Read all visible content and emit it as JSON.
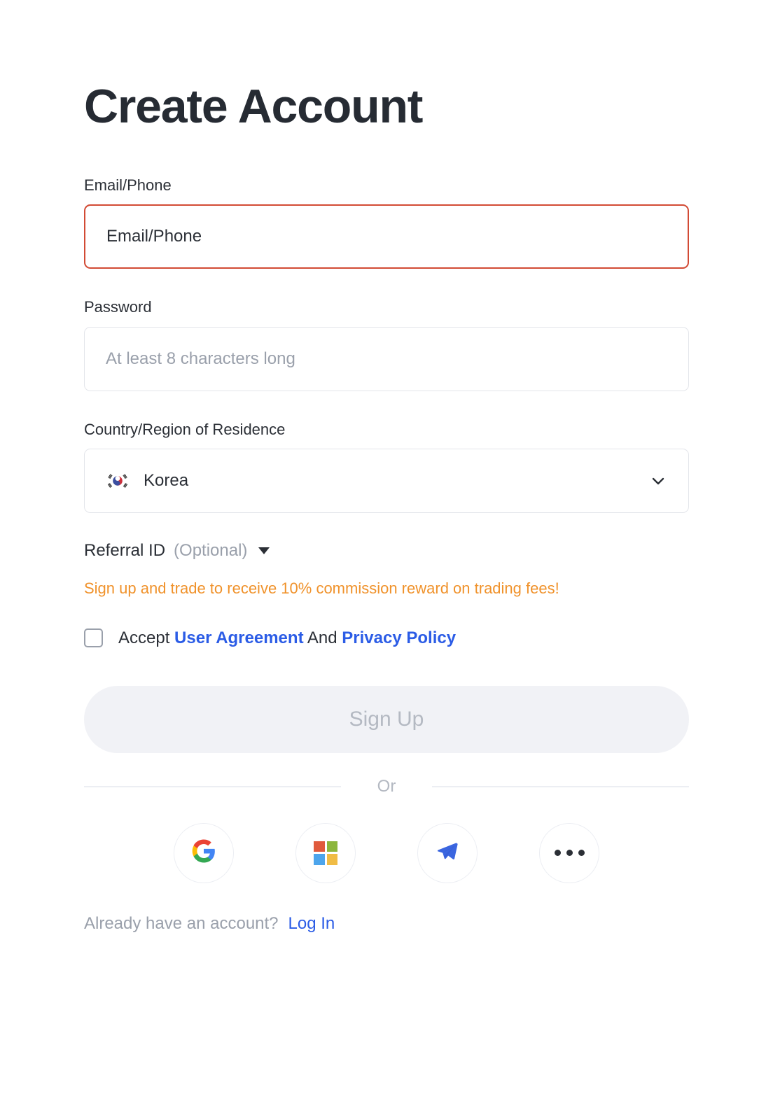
{
  "page": {
    "title": "Create Account"
  },
  "fields": {
    "email": {
      "label": "Email/Phone",
      "value": "Email/Phone",
      "state": "error",
      "border_color": "#d24a34"
    },
    "password": {
      "label": "Password",
      "placeholder": "At least 8 characters long",
      "value": ""
    },
    "country": {
      "label": "Country/Region of Residence",
      "value": "Korea",
      "flag": "flag-korea-icon",
      "chevron": "chevron-down-icon"
    }
  },
  "referral": {
    "label": "Referral ID",
    "optional": "(Optional)",
    "caret": "caret-down-icon",
    "promo": "Sign up and trade to receive 10% commission reward on trading fees!",
    "promo_color": "#f0922b"
  },
  "agreement": {
    "checked": false,
    "accept": "Accept",
    "user_agreement": "User Agreement",
    "and": "And",
    "privacy_policy": "Privacy Policy",
    "link_color": "#2b5ce6"
  },
  "signup": {
    "label": "Sign Up",
    "enabled": false,
    "bg": "#f1f2f6",
    "text_color": "#b4b9c2"
  },
  "divider": {
    "label": "Or"
  },
  "social": {
    "buttons": [
      {
        "name": "google",
        "icon": "google-icon"
      },
      {
        "name": "microsoft",
        "icon": "microsoft-icon"
      },
      {
        "name": "telegram",
        "icon": "telegram-icon"
      },
      {
        "name": "more",
        "icon": "ellipsis-icon"
      }
    ],
    "microsoft_colors": [
      "#e05a3c",
      "#8cb63c",
      "#4da5ec",
      "#f0bc45"
    ],
    "telegram_color": "#3b66e0"
  },
  "footer": {
    "question": "Already have an account?",
    "login_label": "Log In"
  }
}
